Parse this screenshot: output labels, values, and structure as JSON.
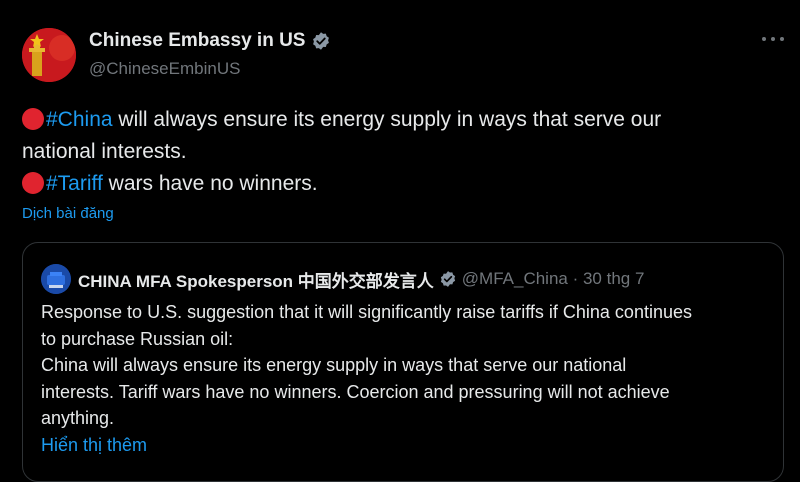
{
  "post": {
    "author_name": "Chinese Embassy in US",
    "author_handle": "@ChineseEmbinUS",
    "lines": [
      {
        "dot": true,
        "hashtag": "#China",
        "text": " will always ensure its energy supply in ways that serve our"
      },
      {
        "dot": false,
        "hashtag": "",
        "text": "national interests."
      },
      {
        "dot": true,
        "hashtag": "#Tariff",
        "text": " wars have no winners."
      }
    ],
    "translate_label": "Dịch bài đăng"
  },
  "quote": {
    "author_name": "CHINA MFA Spokesperson 中国外交部发言人",
    "handle_date": "@MFA_China · 30 thg 7",
    "lines": [
      "Response to U.S. suggestion that it will significantly raise tariffs if China continues",
      "to purchase Russian oil:",
      "China will always ensure its energy supply in ways that serve our national",
      "interests. Tariff wars have no winners. Coercion and pressuring will not achieve",
      "anything."
    ],
    "show_more_label": "Hiển thị thêm"
  },
  "icons": {
    "verified": "verified-badge-icon",
    "more": "more-options-icon",
    "emoji_dot": "red-circle-emoji"
  },
  "colors": {
    "background": "#000000",
    "text": "#e7e9ea",
    "secondary": "#71767b",
    "link": "#1d9bf0",
    "emoji_red": "#e0242f"
  }
}
